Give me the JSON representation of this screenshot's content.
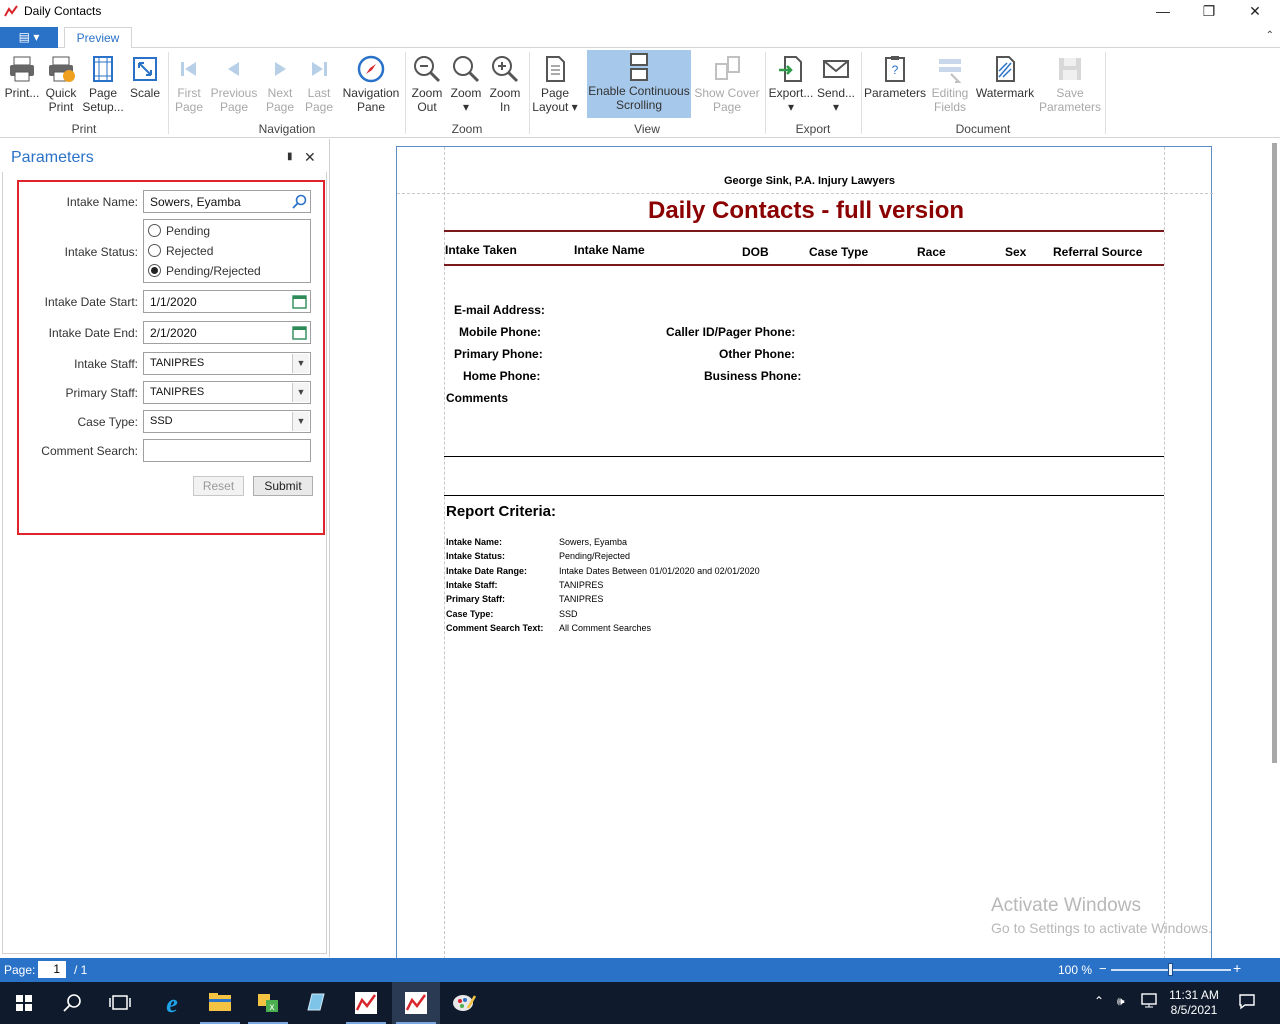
{
  "window": {
    "title": "Daily Contacts"
  },
  "tabs": {
    "file_label": "▤ ▾",
    "preview_label": "Preview"
  },
  "ribbon": {
    "print": {
      "label1": "Print...",
      "label2": ""
    },
    "quick_print": {
      "label1": "Quick",
      "label2": "Print"
    },
    "page_setup": {
      "label1": "Page",
      "label2": "Setup..."
    },
    "scale": {
      "label1": "Scale",
      "label2": ""
    },
    "group_print": "Print",
    "first_page": {
      "label1": "First",
      "label2": "Page"
    },
    "previous_page": {
      "label1": "Previous",
      "label2": "Page"
    },
    "next_page": {
      "label1": "Next",
      "label2": "Page"
    },
    "last_page": {
      "label1": "Last",
      "label2": "Page"
    },
    "navigation_pane": {
      "label1": "Navigation",
      "label2": "Pane"
    },
    "group_navigation": "Navigation",
    "zoom_out": {
      "label1": "Zoom",
      "label2": "Out"
    },
    "zoom": {
      "label1": "Zoom",
      "label2": "▾"
    },
    "zoom_in": {
      "label1": "Zoom",
      "label2": "In"
    },
    "group_zoom": "Zoom",
    "page_layout": {
      "label1": "Page",
      "label2": "Layout ▾"
    },
    "continuous_scrolling": {
      "label1": "Enable Continuous",
      "label2": "Scrolling"
    },
    "show_cover_page": {
      "label1": "Show Cover",
      "label2": "Page"
    },
    "group_view": "View",
    "export": {
      "label1": "Export...",
      "label2": "▾"
    },
    "send": {
      "label1": "Send...",
      "label2": "▾"
    },
    "group_export": "Export",
    "parameters": {
      "label1": "Parameters",
      "label2": ""
    },
    "editing_fields": {
      "label1": "Editing",
      "label2": "Fields"
    },
    "watermark": {
      "label1": "Watermark",
      "label2": ""
    },
    "save_parameters": {
      "label1": "Save",
      "label2": "Parameters"
    },
    "group_document": "Document"
  },
  "parameters_panel": {
    "title": "Parameters",
    "intake_name_label": "Intake Name:",
    "intake_name_value": "Sowers, Eyamba",
    "intake_status_label": "Intake Status:",
    "status_options": [
      "Pending",
      "Rejected",
      "Pending/Rejected"
    ],
    "status_selected": "Pending/Rejected",
    "intake_date_start_label": "Intake Date Start:",
    "intake_date_start_value": "1/1/2020",
    "intake_date_end_label": "Intake Date End:",
    "intake_date_end_value": "2/1/2020",
    "intake_staff_label": "Intake Staff:",
    "intake_staff_value": "TANIPRES",
    "primary_staff_label": "Primary Staff:",
    "primary_staff_value": "TANIPRES",
    "case_type_label": "Case Type:",
    "case_type_value": "SSD",
    "comment_search_label": "Comment Search:",
    "comment_search_value": "",
    "reset_label": "Reset",
    "submit_label": "Submit"
  },
  "report": {
    "company": "George Sink, P.A. Injury Lawyers",
    "title": "Daily Contacts - full version",
    "columns": [
      "Intake Taken",
      "Intake Name",
      "DOB",
      "Case Type",
      "Race",
      "Sex",
      "Referral Source"
    ],
    "fields_left": [
      "E-mail Address:",
      "Mobile Phone:",
      "Primary Phone:",
      "Home Phone:"
    ],
    "fields_right": [
      "Caller ID/Pager Phone:",
      "Other Phone:",
      "Business Phone:"
    ],
    "comments_label": "Comments",
    "criteria_title": "Report Criteria:",
    "criteria": [
      {
        "label": "Intake Name:",
        "value": "Sowers, Eyamba"
      },
      {
        "label": "Intake Status:",
        "value": "Pending/Rejected"
      },
      {
        "label": "Intake Date Range:",
        "value": "Intake Dates Between 01/01/2020 and 02/01/2020"
      },
      {
        "label": "Intake Staff:",
        "value": "TANIPRES"
      },
      {
        "label": "Primary Staff:",
        "value": "TANIPRES"
      },
      {
        "label": "Case Type:",
        "value": "SSD"
      },
      {
        "label": "Comment Search Text:",
        "value": "All Comment Searches"
      }
    ]
  },
  "watermark": {
    "line1": "Activate Windows",
    "line2": "Go to Settings to activate Windows."
  },
  "statusbar": {
    "page_label": "Page:",
    "page_value": "1",
    "page_of": "/ 1",
    "zoom": "100 %",
    "zoom_level_percent": 100
  },
  "taskbar": {
    "time": "11:31 AM",
    "date": "8/5/2021"
  },
  "colors": {
    "accent": "#2a72c8",
    "report_title": "#8b0000",
    "highlight_box": "#e0242b"
  }
}
